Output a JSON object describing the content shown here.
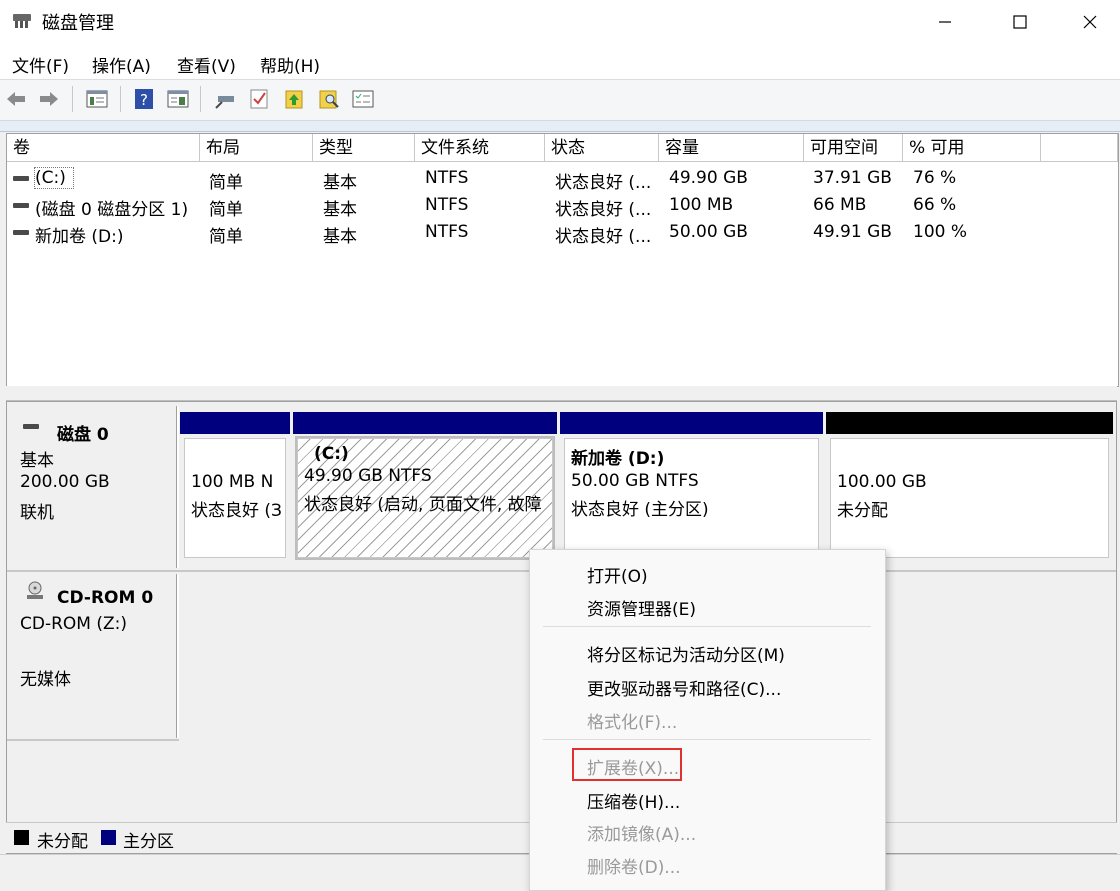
{
  "window": {
    "title": "磁盘管理",
    "minimize": "—",
    "maximize": "☐",
    "close": "✕"
  },
  "menu": [
    "文件(F)",
    "操作(A)",
    "查看(V)",
    "帮助(H)"
  ],
  "toolbar": {
    "icons": [
      "back-arrow-icon",
      "forward-arrow-icon",
      "console-tree-icon",
      "help-icon",
      "properties-view-icon",
      "connect-icon",
      "check-icon",
      "export-icon",
      "find-icon",
      "list-settings-icon"
    ]
  },
  "volume_list": {
    "columns": [
      "卷",
      "布局",
      "类型",
      "文件系统",
      "状态",
      "容量",
      "可用空间",
      "% 可用"
    ],
    "rows": [
      [
        "(C:)",
        "简单",
        "基本",
        "NTFS",
        "状态良好 (...",
        "49.90 GB",
        "37.91 GB",
        "76 %"
      ],
      [
        "(磁盘 0 磁盘分区 1)",
        "简单",
        "基本",
        "NTFS",
        "状态良好 (...",
        "100 MB",
        "66 MB",
        "66 %"
      ],
      [
        "新加卷 (D:)",
        "简单",
        "基本",
        "NTFS",
        "状态良好 (...",
        "50.00 GB",
        "49.91 GB",
        "100 %"
      ]
    ]
  },
  "disk0": {
    "name": "磁盘 0",
    "type": "基本",
    "size": "200.00 GB",
    "status": "联机",
    "partitions": [
      {
        "line1": "",
        "line2": "100 MB N",
        "line3": "状态良好 (З"
      },
      {
        "line1": "(C:)",
        "line2": "49.90 GB NTFS",
        "line3": "状态良好 (启动, 页面文件, 故障"
      },
      {
        "line1": "新加卷  (D:)",
        "line2": "50.00 GB NTFS",
        "line3": "状态良好 (主分区)"
      },
      {
        "line1": "",
        "line2": "100.00 GB",
        "line3": "未分配"
      }
    ]
  },
  "cdrom0": {
    "name": "CD-ROM 0",
    "drive": "CD-ROM (Z:)",
    "media": "无媒体"
  },
  "legend": [
    {
      "label": "未分配",
      "color": "#000000"
    },
    {
      "label": "主分区",
      "color": "#00007f"
    }
  ],
  "colors": {
    "primary_bar": "#00007f",
    "unallocated_bar": "#000000",
    "highlight": "#e03030"
  },
  "context_menu": {
    "group1": [
      "打开(O)",
      "资源管理器(E)"
    ],
    "group2": [
      "将分区标记为活动分区(M)",
      "更改驱动器号和路径(C)...",
      "格式化(F)..."
    ],
    "group3": [
      "扩展卷(X)...",
      "压缩卷(H)...",
      "添加镜像(A)...",
      "删除卷(D)..."
    ]
  }
}
